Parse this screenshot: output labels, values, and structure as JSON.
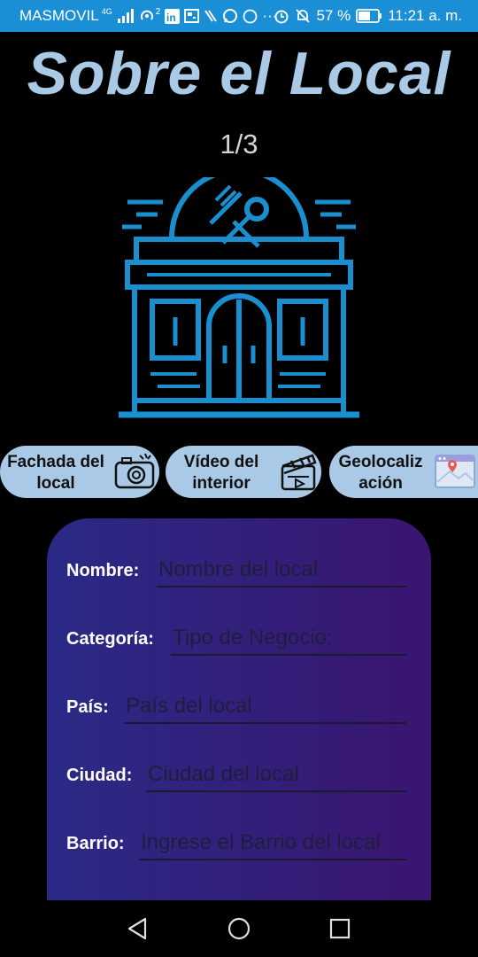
{
  "status_bar": {
    "carrier": "MASMOVIL",
    "network": "4G",
    "hotspot_count": "2",
    "battery": "57 %",
    "time": "11:21 a. m.",
    "dots": "···",
    "colors": {
      "background": "#1b8fd6"
    }
  },
  "header": {
    "title": "Sobre el Local",
    "pager": "1/3"
  },
  "hero": {
    "icon": "restaurant-storefront-icon",
    "color": "#1a8fcf"
  },
  "chips": [
    {
      "label_line1": "Fachada del",
      "label_line2": "local",
      "icon": "camera-icon"
    },
    {
      "label_line1": "Vídeo del",
      "label_line2": "interior",
      "icon": "clapperboard-icon"
    },
    {
      "label_line1": "Geolocaliz",
      "label_line2": "ación",
      "icon": "map-pin-window-icon"
    }
  ],
  "form": {
    "fields": [
      {
        "label": "Nombre:",
        "placeholder": "Nombre del local"
      },
      {
        "label": "Categoría:",
        "placeholder": "Tipo de Negocio:"
      },
      {
        "label": "País:",
        "placeholder": "País del local"
      },
      {
        "label": "Ciudad:",
        "placeholder": "Ciudad del local"
      },
      {
        "label": "Barrio:",
        "placeholder": "Ingrese el Barrio del local"
      }
    ],
    "colors": {
      "gradient_start": "#2a2a86",
      "gradient_end": "#3a1570"
    }
  },
  "nav_bar": {
    "back": "back-triangle-icon",
    "home": "home-circle-icon",
    "recents": "recents-square-icon"
  }
}
